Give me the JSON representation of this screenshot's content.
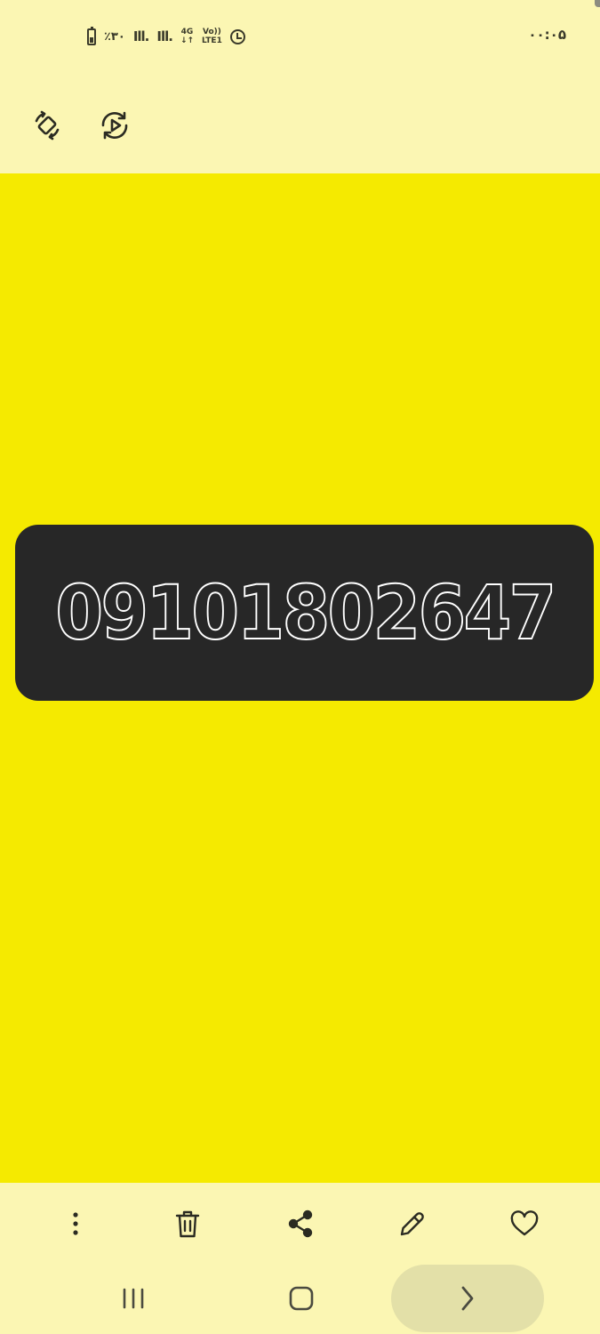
{
  "status_bar": {
    "battery_text": "٪۳۰",
    "signal_1": "Ill.",
    "signal_2": "Ill.",
    "network_top": "4G",
    "network_bottom": "↓↑",
    "volte_top": "Vo))",
    "volte_bottom": "LTE1",
    "time": "۰۰:۰۵",
    "battery_level_percent": 30
  },
  "toolbar": {
    "icons": [
      "rotate-screen-icon",
      "motion-photo-icon"
    ]
  },
  "image": {
    "background_color": "#f5ea00",
    "card_color": "#272727",
    "number_text": "09101802647"
  },
  "actions": {
    "icons": [
      "more-options-icon",
      "delete-icon",
      "share-icon",
      "edit-icon",
      "favorite-icon"
    ]
  },
  "navbar": {
    "icons": [
      "recent-apps-icon",
      "home-icon",
      "forward-icon"
    ]
  }
}
